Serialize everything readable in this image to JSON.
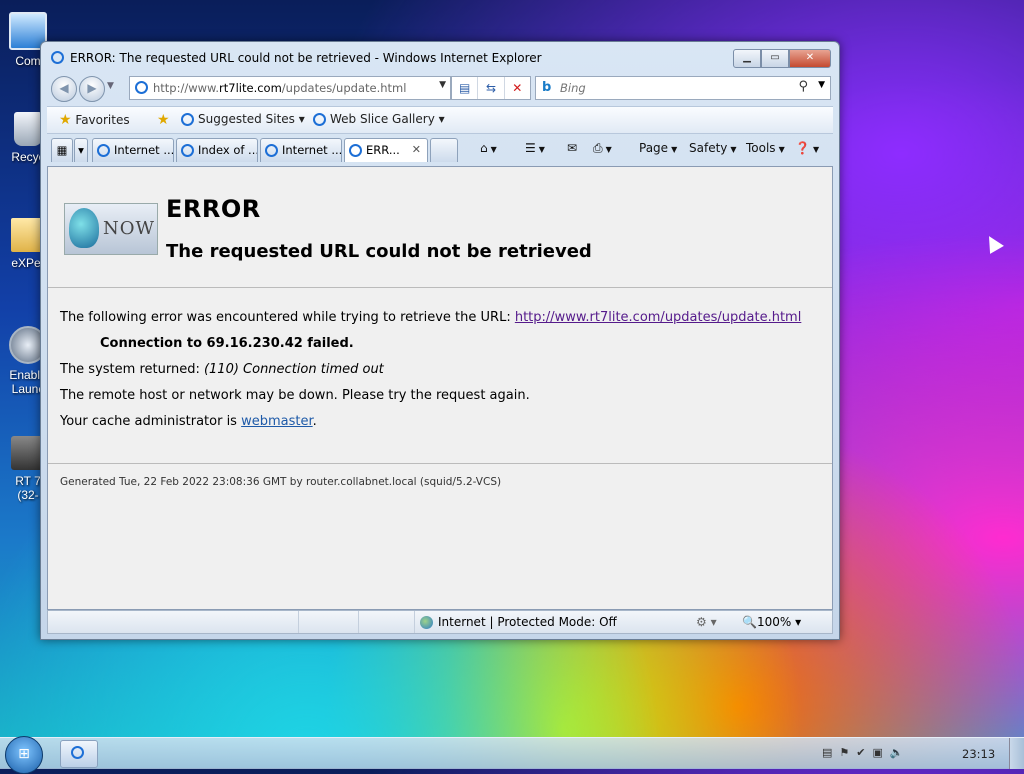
{
  "desktop": {
    "icons": [
      {
        "label": "Com",
        "icon": "computer-icon"
      },
      {
        "label": "Recyc",
        "icon": "recycle-bin-icon"
      },
      {
        "label": "eXPer",
        "icon": "folder-icon"
      },
      {
        "label": "Enable Launc",
        "icon": "launcher-icon"
      },
      {
        "label": "RT 7 (32-",
        "icon": "app-shortcut-icon"
      }
    ]
  },
  "window": {
    "title": "ERROR: The requested URL could not be retrieved - Windows Internet Explorer",
    "address": {
      "url_prefix": "http://www.",
      "url_domain": "rt7lite.com",
      "url_path": "/updates/update.html"
    },
    "search": {
      "placeholder": "Bing"
    },
    "favorites_bar": {
      "favorites_label": "Favorites",
      "items": [
        {
          "label": "Suggested Sites"
        },
        {
          "label": "Web Slice Gallery"
        }
      ]
    },
    "tabs": [
      {
        "label": "Internet ..."
      },
      {
        "label": "Index of ..."
      },
      {
        "label": "Internet ..."
      },
      {
        "label": "ERR..."
      }
    ],
    "command_bar": {
      "page": "Page",
      "safety": "Safety",
      "tools": "Tools"
    },
    "status_bar": {
      "zone": "Internet | Protected Mode: Off",
      "zoom": "100%"
    }
  },
  "page": {
    "logo_text": "NOW",
    "heading": "ERROR",
    "subheading": "The requested URL could not be retrieved",
    "line1_text": "The following error was encountered while trying to retrieve the URL: ",
    "line1_link": "http://www.rt7lite.com/updates/update.html",
    "connection_failed": "Connection to 69.16.230.42 failed.",
    "system_returned_label": "The system returned: ",
    "system_returned_value": "(110) Connection timed out",
    "remote_host": "The remote host or network may be down. Please try the request again.",
    "cache_admin_prefix": "Your cache administrator is ",
    "cache_admin_link": "webmaster",
    "cache_admin_suffix": ".",
    "generated": "Generated Tue, 22 Feb 2022 23:08:36 GMT by router.collabnet.local (squid/5.2-VCS)"
  },
  "taskbar": {
    "clock": "23:13"
  }
}
